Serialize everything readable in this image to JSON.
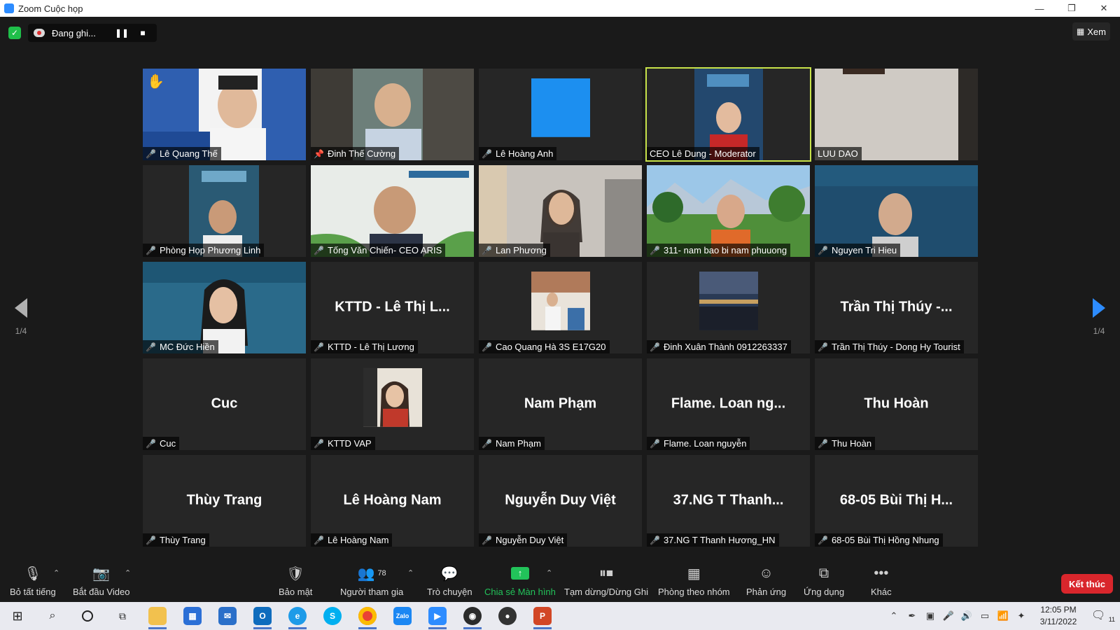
{
  "window": {
    "title": "Zoom Cuộc họp",
    "minimize_glyph": "—",
    "maximize_glyph": "❐",
    "close_glyph": "✕"
  },
  "topbar": {
    "recording_label": "Đang ghi...",
    "view_label": "Xem",
    "pause_glyph": "❚❚",
    "stop_glyph": "■"
  },
  "pagination": {
    "left": "1/4",
    "right": "1/4"
  },
  "participants": [
    {
      "name": "Lê Quang Thế",
      "video": "video-person",
      "color": "#2f5fb0"
    },
    {
      "name": "Đinh Thế Cường",
      "video": "video-person",
      "color": "#6d7f7a"
    },
    {
      "name": "Lê Hoàng Anh",
      "video": "thumbnail-blue",
      "color": "#1c8ff0"
    },
    {
      "name": "CEO Lê Dung - Moderator",
      "video": "video-banner",
      "color": "#23486e"
    },
    {
      "name": "LUU DAO",
      "video": "video-wall",
      "color": "#cfcac4"
    },
    {
      "name": "Phòng Họp Phương Linh",
      "video": "video-banner",
      "color": "#2a5a74"
    },
    {
      "name": "Tống Văn Chiến- CEO ARIS",
      "video": "video-person",
      "color": "#e8ece8"
    },
    {
      "name": "Lan Phương",
      "video": "video-person",
      "color": "#c8c3bd"
    },
    {
      "name": "311- nam bao bi nam phuuong",
      "video": "video-landscape",
      "color": "#4f8f3a"
    },
    {
      "name": "Nguyen Tri Hieu",
      "video": "video-banner",
      "color": "#1f4d6e"
    },
    {
      "name": "MC Đức Hiền",
      "video": "video-banner",
      "color": "#2a6a8a"
    },
    {
      "name": "KTTD - Lê Thị Lương",
      "display": "KTTD - Lê Thị L...",
      "video": "none"
    },
    {
      "name": "Cao Quang Hà 3S E17G20",
      "video": "thumbnail-photo",
      "color": "#b07a5a"
    },
    {
      "name": "Đinh Xuân Thành 0912263337",
      "video": "thumbnail-night",
      "color": "#2a3a55"
    },
    {
      "name": "Trần Thị Thúy - Dong Hy Tourist",
      "display": "Trần Thị Thúy -...",
      "video": "none"
    },
    {
      "name": "Cuc",
      "display": "Cuc",
      "video": "none"
    },
    {
      "name": "KTTD VAP",
      "video": "thumbnail-portrait",
      "color": "#c0392b"
    },
    {
      "name": "Nam Phạm",
      "display": "Nam Phạm",
      "video": "none"
    },
    {
      "name": "Flame. Loan nguyễn",
      "display": "Flame. Loan ng...",
      "video": "none"
    },
    {
      "name": "Thu Hoàn",
      "display": "Thu Hoàn",
      "video": "none"
    },
    {
      "name": "Thùy Trang",
      "display": "Thùy Trang",
      "video": "none"
    },
    {
      "name": "Lê Hoàng Nam",
      "display": "Lê Hoàng Nam",
      "video": "none"
    },
    {
      "name": "Nguyễn Duy Việt",
      "display": "Nguyễn Duy Việt",
      "video": "none"
    },
    {
      "name": "37.NG T Thanh Hương_HN",
      "display": "37.NG T Thanh...",
      "video": "none"
    },
    {
      "name": "68-05 Bùi Thị Hồng Nhung",
      "display": "68-05 Bùi Thị H...",
      "video": "none"
    }
  ],
  "toolbar": {
    "mute_all": "Bỏ tất tiếng",
    "start_video": "Bắt đầu Video",
    "security": "Bảo mật",
    "participants": "Người tham gia",
    "participant_count": "78",
    "chat": "Trò chuyện",
    "share_screen": "Chia sẻ Màn hình",
    "pause_stop": "Tạm dừng/Dừng Ghi",
    "breakout": "Phòng theo nhóm",
    "reactions": "Phản ứng",
    "apps": "Ứng dụng",
    "more": "Khác",
    "end": "Kết thúc"
  },
  "taskbar": {
    "time": "12:05 PM",
    "date": "3/11/2022",
    "notification_count": "11",
    "apps": [
      "windows",
      "search",
      "cortana",
      "task-view",
      "file-explorer",
      "store",
      "mail",
      "outlook",
      "edge",
      "skype",
      "chrome",
      "zalo",
      "zoom",
      "obs",
      "camera",
      "powerpoint"
    ]
  },
  "colors": {
    "accent": "#2d8cff",
    "active_speaker": "#c8e34a",
    "end_button": "#d9262c",
    "share_green": "#22c35a",
    "muted_red": "#e0453a"
  }
}
